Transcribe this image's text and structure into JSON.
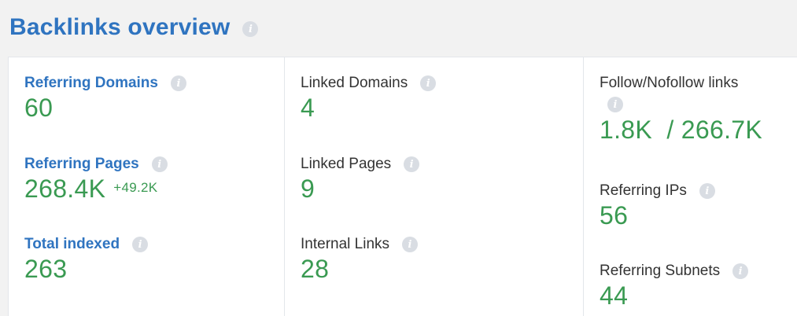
{
  "header": {
    "title": "Backlinks overview",
    "info_icon": "info-icon"
  },
  "col1": {
    "referring_domains": {
      "label": "Referring Domains",
      "value": "60"
    },
    "referring_pages": {
      "label": "Referring Pages",
      "value": "268.4K",
      "delta": "+49.2K"
    },
    "total_indexed": {
      "label": "Total indexed",
      "value": "263"
    }
  },
  "col2": {
    "linked_domains": {
      "label": "Linked Domains",
      "value": "4"
    },
    "linked_pages": {
      "label": "Linked Pages",
      "value": "9"
    },
    "internal_links": {
      "label": "Internal Links",
      "value": "28"
    }
  },
  "col3": {
    "follow_nofollow": {
      "label": "Follow/Nofollow links",
      "value": "1.8K  / 266.7K"
    },
    "referring_ips": {
      "label": "Referring IPs",
      "value": "56"
    },
    "referring_subnets": {
      "label": "Referring Subnets",
      "value": "44"
    }
  },
  "colors": {
    "title_blue": "#2f74c0",
    "value_green": "#3a9a52",
    "info_icon_gray": "#d9dde3"
  }
}
